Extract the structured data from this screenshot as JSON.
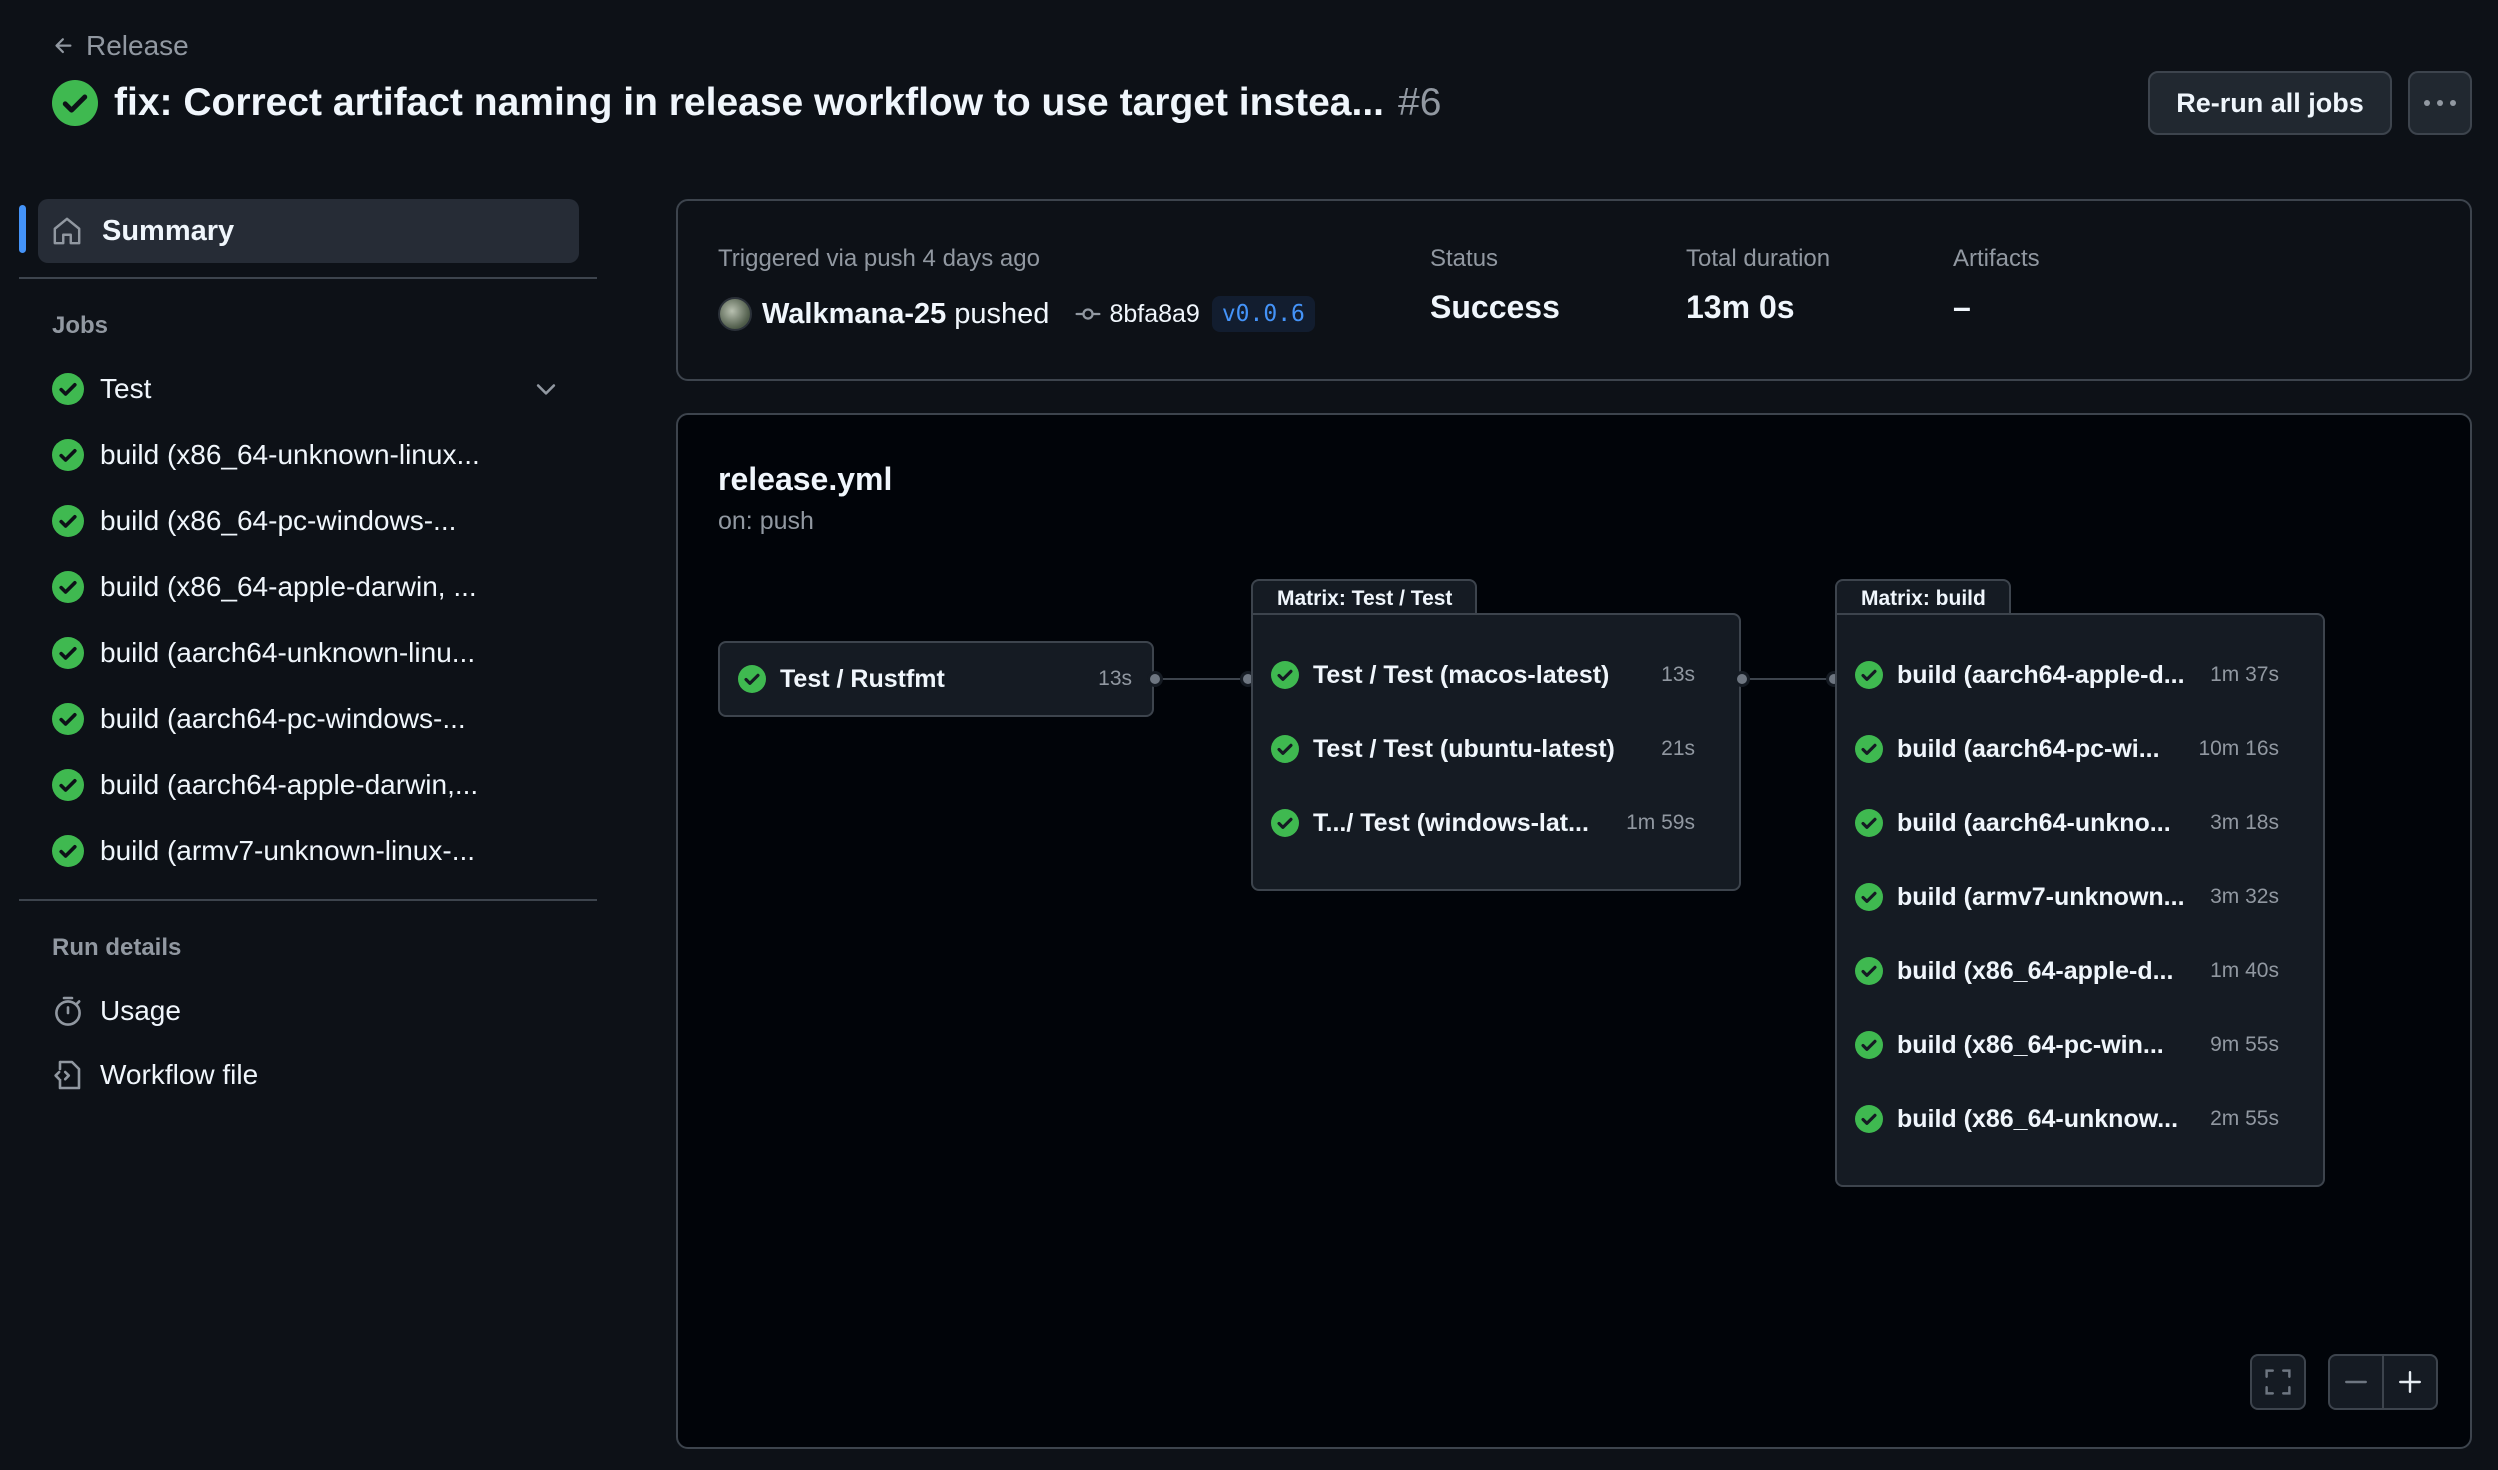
{
  "header": {
    "back_label": "Release",
    "title": "fix: Correct artifact naming in release workflow to use target instea...",
    "run_number": "#6",
    "rerun_label": "Re-run all jobs",
    "more_label": "···"
  },
  "sidebar": {
    "summary_label": "Summary",
    "jobs_heading": "Jobs",
    "jobs": [
      {
        "label": "Test",
        "status": "success"
      },
      {
        "label": "build (x86_64-unknown-linux...",
        "status": "success"
      },
      {
        "label": "build (x86_64-pc-windows-...",
        "status": "success"
      },
      {
        "label": "build (x86_64-apple-darwin, ...",
        "status": "success"
      },
      {
        "label": "build (aarch64-unknown-linu...",
        "status": "success"
      },
      {
        "label": "build (aarch64-pc-windows-...",
        "status": "success"
      },
      {
        "label": "build (aarch64-apple-darwin,...",
        "status": "success"
      },
      {
        "label": "build (armv7-unknown-linux-...",
        "status": "success"
      }
    ],
    "run_details_heading": "Run details",
    "usage_label": "Usage",
    "workflow_file_label": "Workflow file"
  },
  "summary": {
    "triggered_label": "Triggered via push 4 days ago",
    "actor": "Walkmana-25",
    "action": "pushed",
    "commit_sha": "8bfa8a9",
    "tag": "v0.0.6",
    "status_label": "Status",
    "status_value": "Success",
    "duration_label": "Total duration",
    "duration_value": "13m 0s",
    "artifacts_label": "Artifacts",
    "artifacts_value": "–"
  },
  "graph": {
    "workflow_file": "release.yml",
    "trigger": "on: push",
    "rustfmt_job": {
      "name": "Test / Rustfmt",
      "duration": "13s"
    },
    "test_matrix": {
      "title": "Matrix: Test / Test",
      "jobs": [
        {
          "name": "Test / Test (macos-latest)",
          "duration": "13s"
        },
        {
          "name": "Test / Test (ubuntu-latest)",
          "duration": "21s"
        },
        {
          "name": "T.../ Test (windows-lat...",
          "duration": "1m 59s"
        }
      ]
    },
    "build_matrix": {
      "title": "Matrix: build",
      "jobs": [
        {
          "name": "build (aarch64-apple-d...",
          "duration": "1m 37s"
        },
        {
          "name": "build (aarch64-pc-wi...",
          "duration": "10m 16s"
        },
        {
          "name": "build (aarch64-unkno...",
          "duration": "3m 18s"
        },
        {
          "name": "build (armv7-unknown...",
          "duration": "3m 32s"
        },
        {
          "name": "build (x86_64-apple-d...",
          "duration": "1m 40s"
        },
        {
          "name": "build (x86_64-pc-win...",
          "duration": "9m 55s"
        },
        {
          "name": "build (x86_64-unknow...",
          "duration": "2m 55s"
        }
      ]
    }
  },
  "colors": {
    "background": "#0d1117",
    "success": "#3fb950",
    "accent": "#4493f8",
    "border": "#3d444d"
  }
}
